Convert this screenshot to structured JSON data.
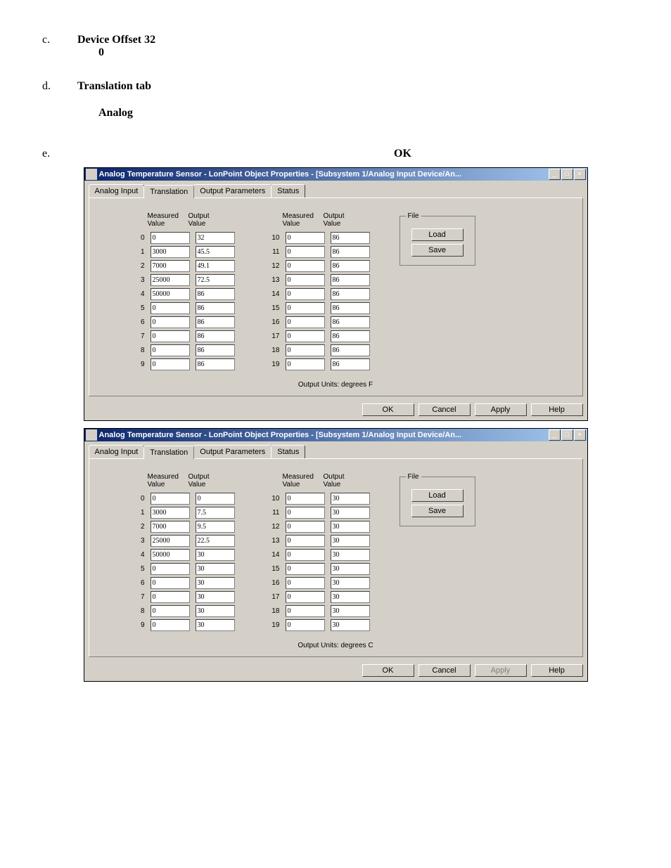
{
  "doc": {
    "item_c_marker": "c.",
    "item_c_line1": "Device Offset            32",
    "item_c_line2": "0",
    "item_d_marker": "d.",
    "item_d_line1": "Translation tab",
    "item_d_line2": "Analog",
    "item_e_marker": "e.",
    "item_e_right": "OK"
  },
  "dialogF": {
    "title": "Analog Temperature Sensor - LonPoint Object Properties - [Subsystem 1/Analog Input Device/An...",
    "tabs": [
      "Analog Input",
      "Translation",
      "Output Parameters",
      "Status"
    ],
    "active_tab": 1,
    "headers": {
      "mv": "Measured\nValue",
      "ov": "Output\nValue"
    },
    "left": [
      {
        "i": "0",
        "m": "0",
        "o": "32"
      },
      {
        "i": "1",
        "m": "3000",
        "o": "45.5"
      },
      {
        "i": "2",
        "m": "7000",
        "o": "49.1"
      },
      {
        "i": "3",
        "m": "25000",
        "o": "72.5"
      },
      {
        "i": "4",
        "m": "50000",
        "o": "86"
      },
      {
        "i": "5",
        "m": "0",
        "o": "86"
      },
      {
        "i": "6",
        "m": "0",
        "o": "86"
      },
      {
        "i": "7",
        "m": "0",
        "o": "86"
      },
      {
        "i": "8",
        "m": "0",
        "o": "86"
      },
      {
        "i": "9",
        "m": "0",
        "o": "86"
      }
    ],
    "right": [
      {
        "i": "10",
        "m": "0",
        "o": "86"
      },
      {
        "i": "11",
        "m": "0",
        "o": "86"
      },
      {
        "i": "12",
        "m": "0",
        "o": "86"
      },
      {
        "i": "13",
        "m": "0",
        "o": "86"
      },
      {
        "i": "14",
        "m": "0",
        "o": "86"
      },
      {
        "i": "15",
        "m": "0",
        "o": "86"
      },
      {
        "i": "16",
        "m": "0",
        "o": "86"
      },
      {
        "i": "17",
        "m": "0",
        "o": "86"
      },
      {
        "i": "18",
        "m": "0",
        "o": "86"
      },
      {
        "i": "19",
        "m": "0",
        "o": "86"
      }
    ],
    "file": {
      "legend": "File",
      "load": "Load",
      "save": "Save"
    },
    "output_units": "Output Units:  degrees F",
    "buttons": {
      "ok": "OK",
      "cancel": "Cancel",
      "apply": "Apply",
      "help": "Help",
      "apply_disabled": false
    }
  },
  "dialogC": {
    "title": "Analog Temperature Sensor - LonPoint Object Properties - [Subsystem 1/Analog Input Device/An...",
    "tabs": [
      "Analog Input",
      "Translation",
      "Output Parameters",
      "Status"
    ],
    "active_tab": 1,
    "headers": {
      "mv": "Measured\nValue",
      "ov": "Output\nValue"
    },
    "left": [
      {
        "i": "0",
        "m": "0",
        "o": "0"
      },
      {
        "i": "1",
        "m": "3000",
        "o": "7.5"
      },
      {
        "i": "2",
        "m": "7000",
        "o": "9.5"
      },
      {
        "i": "3",
        "m": "25000",
        "o": "22.5"
      },
      {
        "i": "4",
        "m": "50000",
        "o": "30"
      },
      {
        "i": "5",
        "m": "0",
        "o": "30"
      },
      {
        "i": "6",
        "m": "0",
        "o": "30"
      },
      {
        "i": "7",
        "m": "0",
        "o": "30"
      },
      {
        "i": "8",
        "m": "0",
        "o": "30"
      },
      {
        "i": "9",
        "m": "0",
        "o": "30"
      }
    ],
    "right": [
      {
        "i": "10",
        "m": "0",
        "o": "30"
      },
      {
        "i": "11",
        "m": "0",
        "o": "30"
      },
      {
        "i": "12",
        "m": "0",
        "o": "30"
      },
      {
        "i": "13",
        "m": "0",
        "o": "30"
      },
      {
        "i": "14",
        "m": "0",
        "o": "30"
      },
      {
        "i": "15",
        "m": "0",
        "o": "30"
      },
      {
        "i": "16",
        "m": "0",
        "o": "30"
      },
      {
        "i": "17",
        "m": "0",
        "o": "30"
      },
      {
        "i": "18",
        "m": "0",
        "o": "30"
      },
      {
        "i": "19",
        "m": "0",
        "o": "30"
      }
    ],
    "file": {
      "legend": "File",
      "load": "Load",
      "save": "Save"
    },
    "output_units": "Output Units:  degrees C",
    "buttons": {
      "ok": "OK",
      "cancel": "Cancel",
      "apply": "Apply",
      "help": "Help",
      "apply_disabled": true
    }
  }
}
